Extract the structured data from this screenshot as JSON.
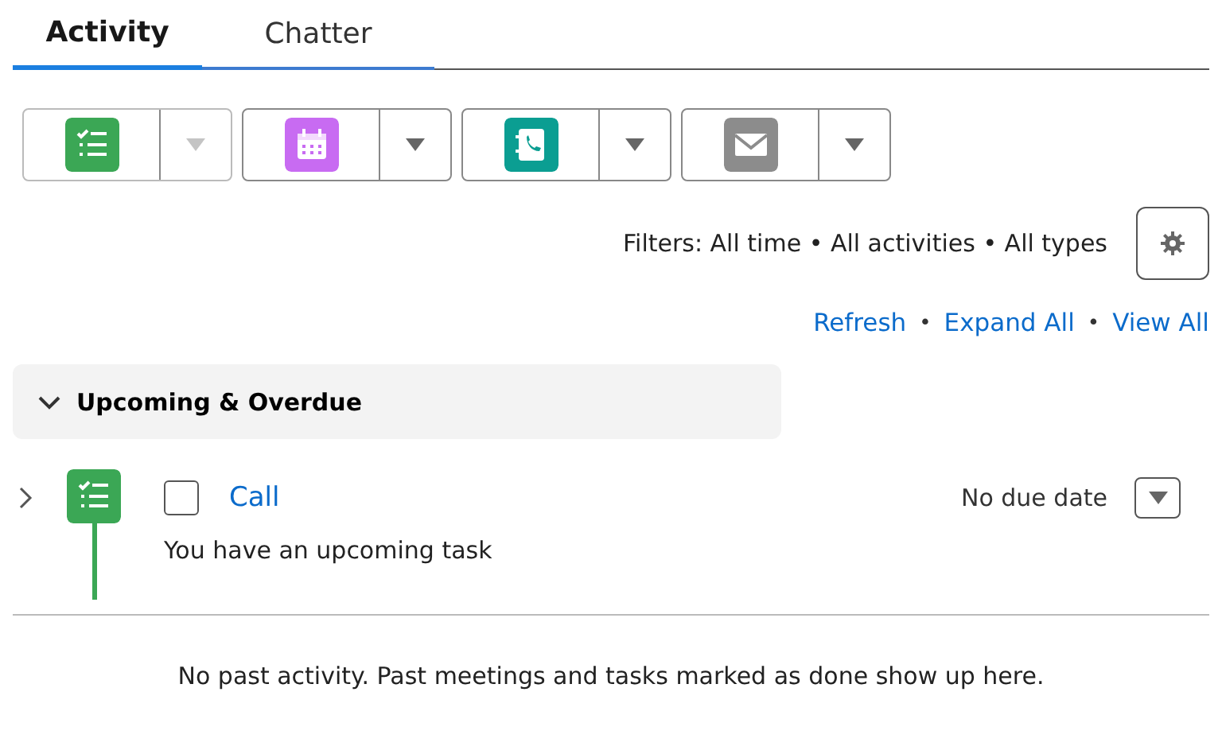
{
  "tabs": [
    {
      "label": "Activity",
      "selected": true
    },
    {
      "label": "Chatter",
      "selected": false
    }
  ],
  "action_buttons": [
    {
      "kind": "task",
      "menu_disabled": true
    },
    {
      "kind": "event",
      "menu_disabled": false
    },
    {
      "kind": "call",
      "menu_disabled": false
    },
    {
      "kind": "email",
      "menu_disabled": false
    }
  ],
  "filters": {
    "text": "Filters: All time • All activities • All types"
  },
  "links": {
    "separator": "•",
    "items": [
      "Refresh",
      "Expand All",
      "View All"
    ]
  },
  "section": {
    "title": "Upcoming & Overdue",
    "expanded": true
  },
  "items": [
    {
      "kind": "task",
      "title": "Call",
      "checked": false,
      "expanded": false,
      "due": "No due date",
      "description": "You have an upcoming task"
    }
  ],
  "empty_message": "No past activity. Past meetings and tasks marked as done show up here."
}
